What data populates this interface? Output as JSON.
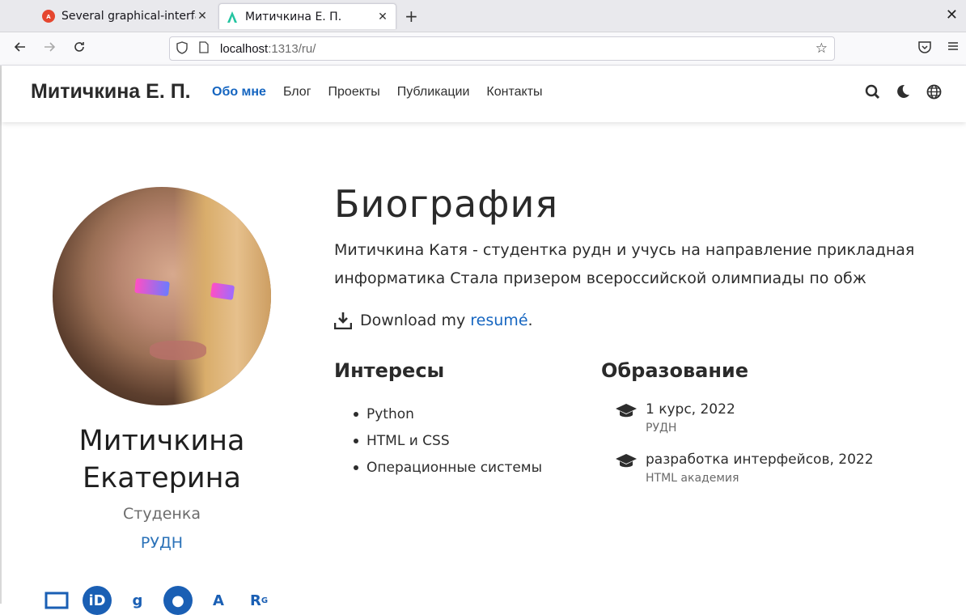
{
  "browser": {
    "tabs": [
      {
        "title": "Several graphical-interfac",
        "favicon": "gnome-icon"
      },
      {
        "title": "Митичкина Е. П.",
        "favicon": "hugo-academic-icon",
        "active": true
      }
    ],
    "url_host": "localhost",
    "url_path": ":1313/ru/"
  },
  "site": {
    "brand": "Митичкина Е. П.",
    "menu": [
      "Обо мне",
      "Блог",
      "Проекты",
      "Публикации",
      "Контакты"
    ]
  },
  "profile": {
    "name_line1": "Митичкина",
    "name_line2": "Екатерина",
    "role": "Студенка",
    "org": "РУДН"
  },
  "bio": {
    "title": "Биография",
    "text": "Митичкина Катя - студентка рудн и учусь на направление прикладная информатика Стала призером всероссийской олимпиады по обж",
    "download_prefix": "Download my ",
    "download_link": "resumé",
    "download_suffix": "."
  },
  "interests": {
    "title": "Интересы",
    "items": [
      "Python",
      "HTML и CSS",
      "Операционные системы"
    ]
  },
  "education": {
    "title": "Образование",
    "items": [
      {
        "course": "1 курс, 2022",
        "institution": "РУДН"
      },
      {
        "course": "разработка интерфейсов, 2022",
        "institution": "HTML академия"
      }
    ]
  },
  "colors": {
    "accent": "#1565c0",
    "org": "#2b72b8"
  }
}
